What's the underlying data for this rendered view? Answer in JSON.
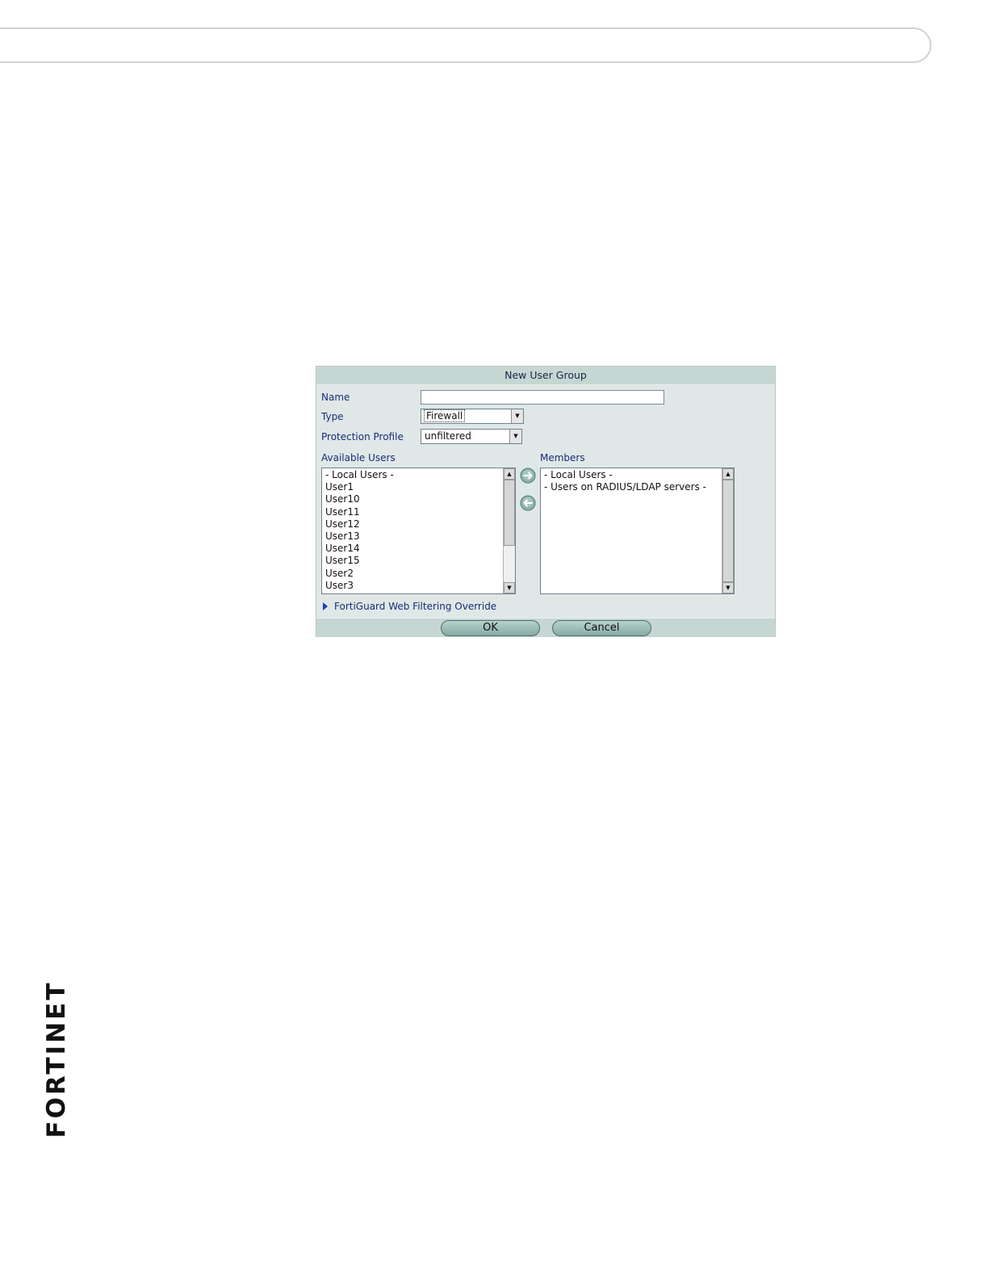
{
  "dialog": {
    "title": "New User Group",
    "name_label": "Name",
    "name_value": "",
    "type_label": "Type",
    "type_value": "Firewall",
    "profile_label": "Protection Profile",
    "profile_value": "unfiltered",
    "available_label": "Available Users",
    "available_users": [
      "- Local Users -",
      "User1",
      "User10",
      "User11",
      "User12",
      "User13",
      "User14",
      "User15",
      "User2",
      "User3"
    ],
    "members_label": "Members",
    "members": [
      "- Local Users -",
      "- Users on RADIUS/LDAP servers -"
    ],
    "override_label": "FortiGuard Web Filtering Override",
    "ok_label": "OK",
    "cancel_label": "Cancel"
  },
  "icons": {
    "add_member": "arrow-right-circle-icon",
    "remove_member": "arrow-left-circle-icon",
    "expand": "triangle-right-icon"
  },
  "logo": {
    "text": "FORTINET"
  },
  "colors": {
    "dialog_bg": "#dfe8e6",
    "title_bar": "#c6d6d3",
    "label_text": "#1a2b7a",
    "logo_accent": "#d61f26"
  }
}
